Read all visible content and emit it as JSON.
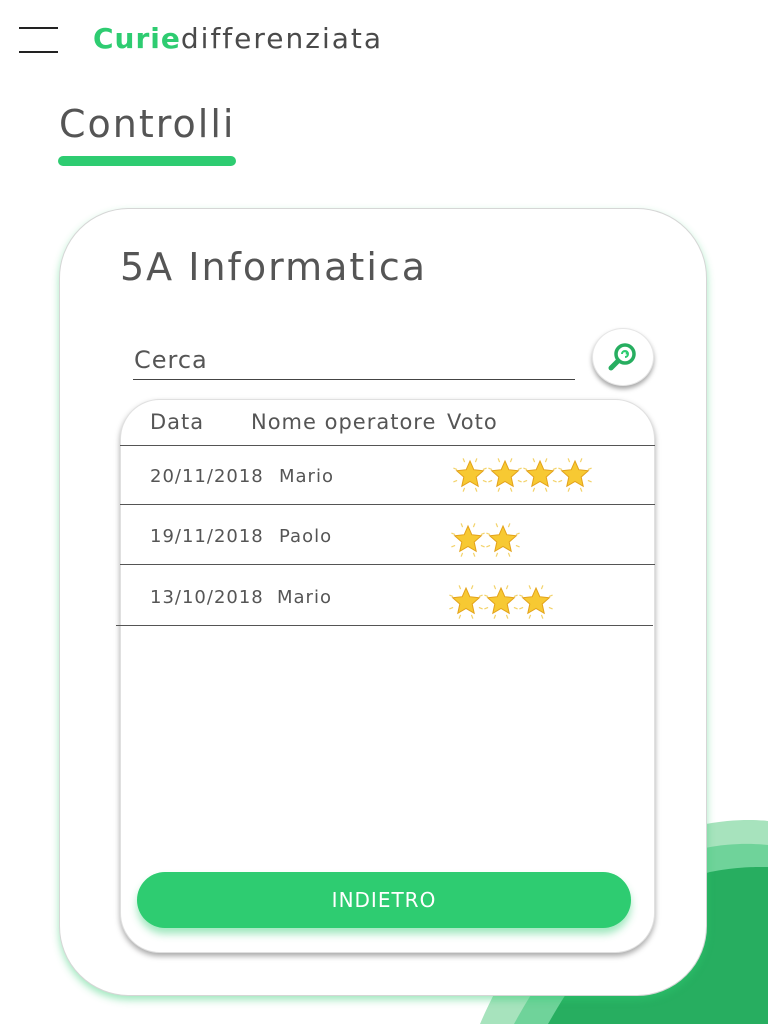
{
  "header": {
    "brand_strong": "Curie",
    "brand_light": "differenziata"
  },
  "page": {
    "title": "Controlli"
  },
  "card": {
    "class_name": "5A Informatica",
    "search_placeholder": "Cerca",
    "back_label": "INDIETRO"
  },
  "table": {
    "columns": [
      "Data",
      "Nome operatore",
      "Voto"
    ],
    "rows": [
      {
        "date": "20/11/2018",
        "operator": "Mario",
        "rating": 4
      },
      {
        "date": "19/11/2018",
        "operator": "Paolo",
        "rating": 2
      },
      {
        "date": "13/10/2018",
        "operator": "Mario",
        "rating": 3
      }
    ]
  },
  "colors": {
    "accent": "#2ecc71",
    "star": "#f7c933",
    "text": "#555555"
  },
  "icons": {
    "menu": "hamburger-icon",
    "search": "magnifier-icon",
    "rating": "star-icon"
  }
}
